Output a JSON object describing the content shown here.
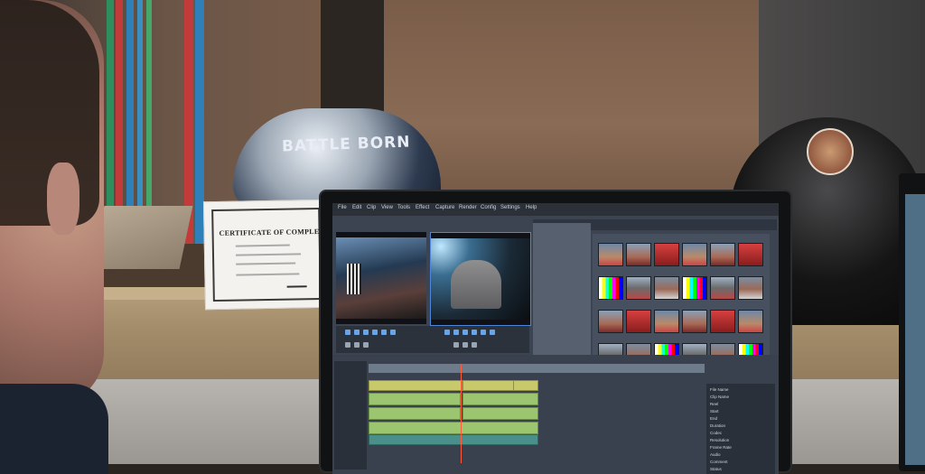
{
  "scene": {
    "helmet_text": "BATTLE BORN",
    "certificate_title": "CERTIFICATE OF COMPLETION"
  },
  "app": {
    "menu": [
      "File",
      "Edit",
      "Clip",
      "View",
      "Tools",
      "Effect",
      "Capture",
      "Render",
      "Config",
      "Settings",
      "Help"
    ],
    "thumbnails_rows": 4,
    "thumbnails_cols": 6,
    "info_labels": [
      "File Name",
      "Clip Name",
      "Reel",
      "Start",
      "End",
      "Duration",
      "Codec",
      "Resolution",
      "Frame Rate",
      "Audio",
      "Comment",
      "Status"
    ],
    "colors": {
      "accent": "#4f86d8",
      "clip_green": "#9bc56e",
      "clip_yellow": "#c8c96a",
      "clip_teal": "#4a8f89",
      "playhead": "#ff5a3c"
    }
  }
}
